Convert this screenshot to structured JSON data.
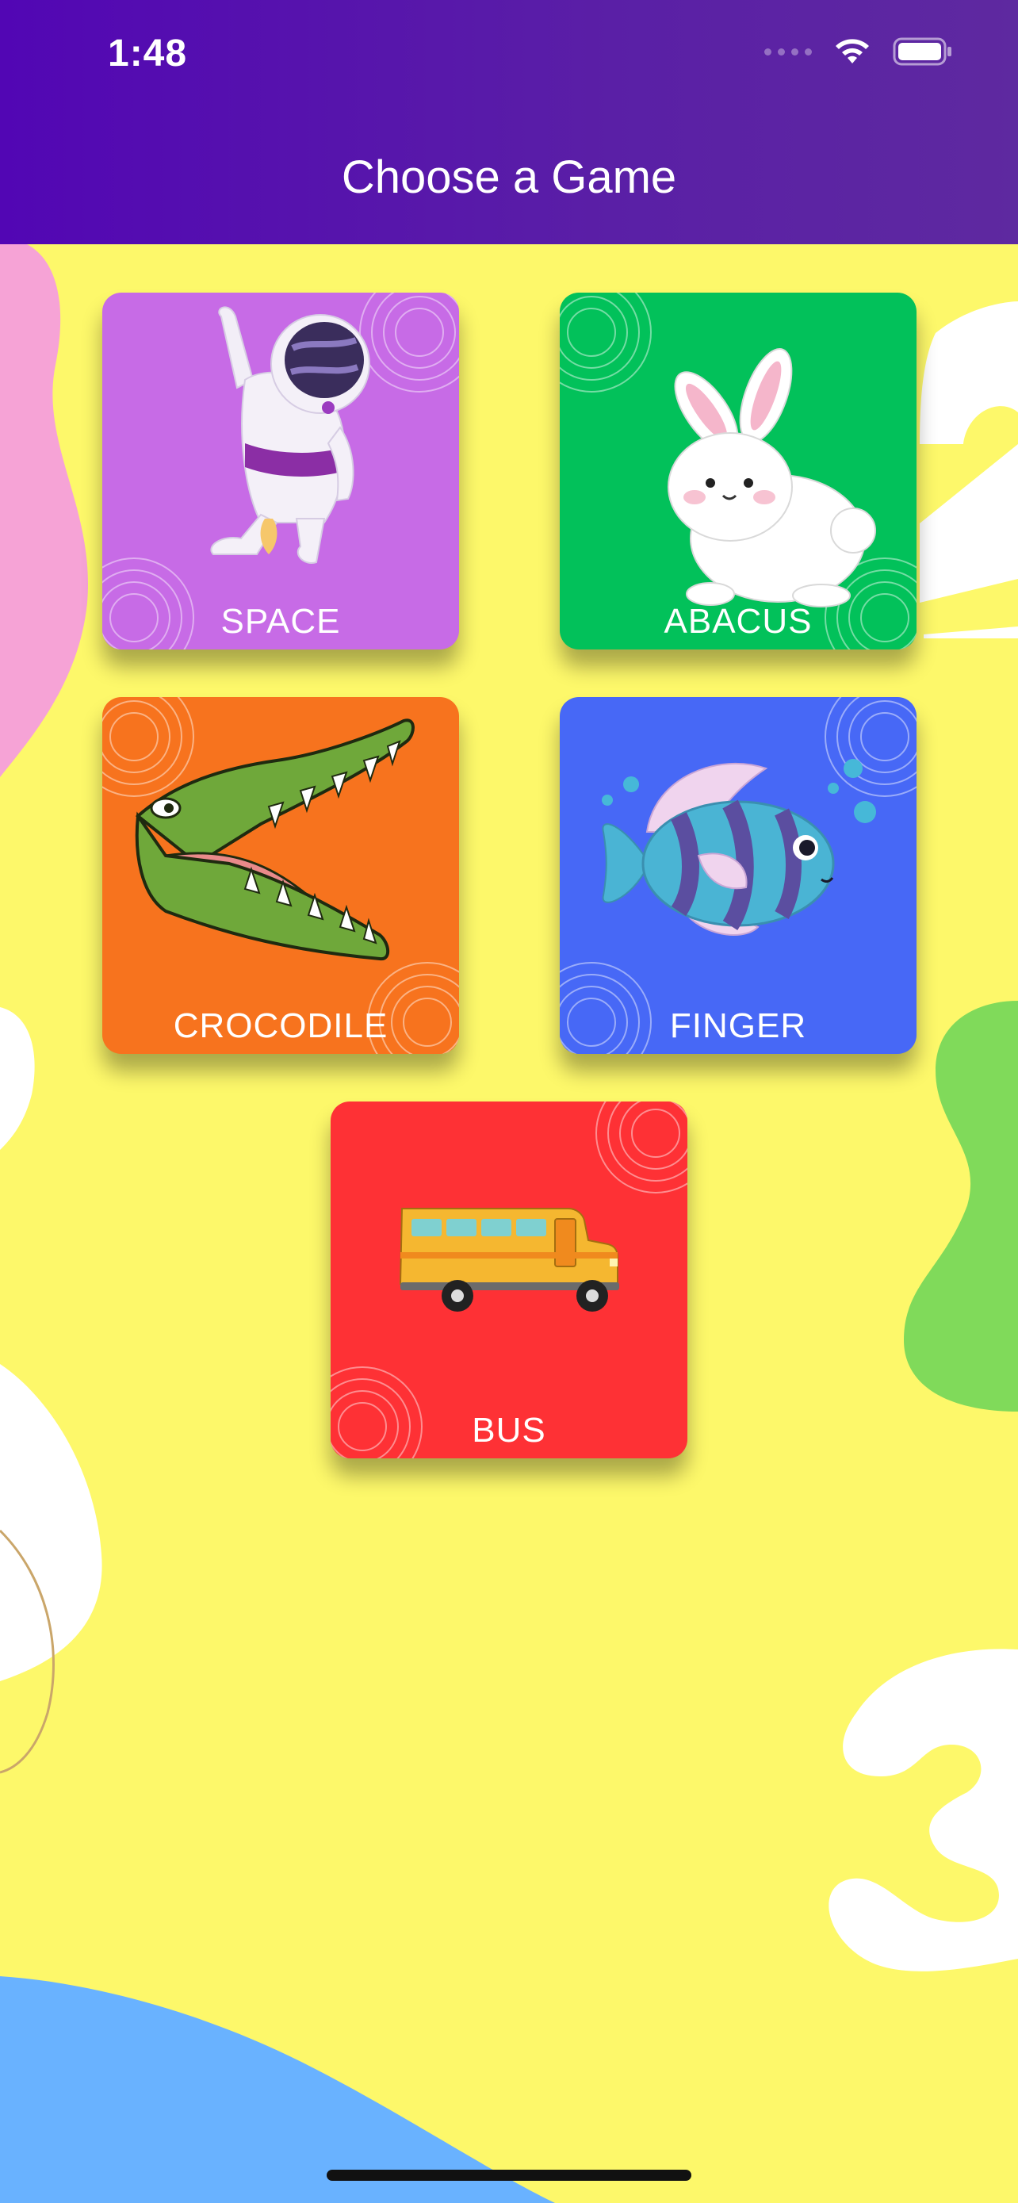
{
  "status_bar": {
    "time": "1:48",
    "icons": [
      "cellular-signal-icon",
      "wifi-icon",
      "battery-icon"
    ]
  },
  "header": {
    "title": "Choose a Game",
    "background_colors": [
      "#5206b4",
      "#5e29a0"
    ]
  },
  "background": {
    "color": "#fdf86a",
    "decorations": [
      "pink-blob",
      "white-number-2",
      "green-blob",
      "white-number-3",
      "blue-wave"
    ]
  },
  "games": [
    {
      "label": "SPACE",
      "color": "#c76be6",
      "image": "astronaut-illustration"
    },
    {
      "label": "ABACUS",
      "color": "#02c15a",
      "image": "bunny-illustration"
    },
    {
      "label": "CROCODILE",
      "color": "#f7731e",
      "image": "crocodile-illustration"
    },
    {
      "label": "FINGER",
      "color": "#4768f6",
      "image": "fish-illustration"
    },
    {
      "label": "BUS",
      "color": "#fe3135",
      "image": "school-bus-illustration"
    }
  ]
}
